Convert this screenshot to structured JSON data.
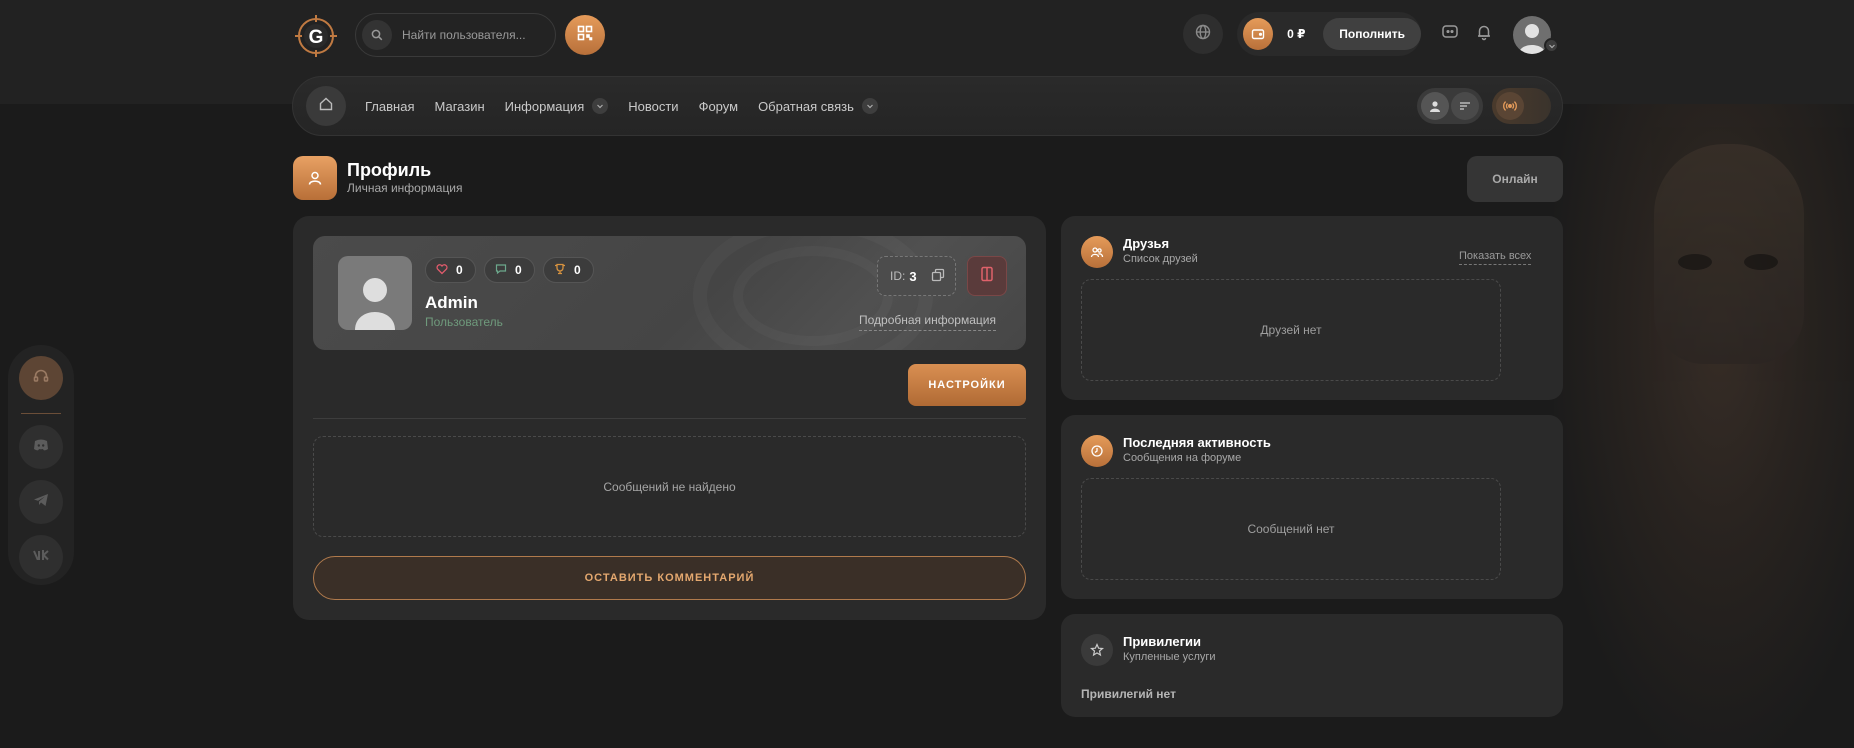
{
  "header": {
    "logo_letter": "G",
    "search_placeholder": "Найти пользователя...",
    "balance": "0 ₽",
    "topup_label": "Пополнить"
  },
  "nav": {
    "items": [
      {
        "label": "Главная",
        "dropdown": false
      },
      {
        "label": "Магазин",
        "dropdown": false
      },
      {
        "label": "Информация",
        "dropdown": true
      },
      {
        "label": "Новости",
        "dropdown": false
      },
      {
        "label": "Форум",
        "dropdown": false
      },
      {
        "label": "Обратная связь",
        "dropdown": true
      }
    ]
  },
  "page": {
    "title": "Профиль",
    "subtitle": "Личная информация",
    "online_label": "Онлайн"
  },
  "profile": {
    "likes": "0",
    "comments": "0",
    "trophies": "0",
    "username": "Admin",
    "role": "Пользователь",
    "id_label": "ID:",
    "id_value": "3",
    "more_info": "Подробная информация",
    "settings_label": "НАСТРОЙКИ",
    "no_messages": "Сообщений не найдено",
    "comment_button": "ОСТАВИТЬ КОММЕНТАРИЙ"
  },
  "friends": {
    "title": "Друзья",
    "subtitle": "Список друзей",
    "show_all": "Показать всех",
    "empty": "Друзей нет"
  },
  "activity": {
    "title": "Последняя активность",
    "subtitle": "Сообщения на форуме",
    "empty": "Сообщений нет"
  },
  "privileges": {
    "title": "Привилегии",
    "subtitle": "Купленные услуги",
    "empty": "Привилегий нет"
  },
  "colors": {
    "accent": "#d98f52",
    "background": "#1b1b1b",
    "card": "#2a2a2a",
    "role_green": "#6f9a7c"
  }
}
